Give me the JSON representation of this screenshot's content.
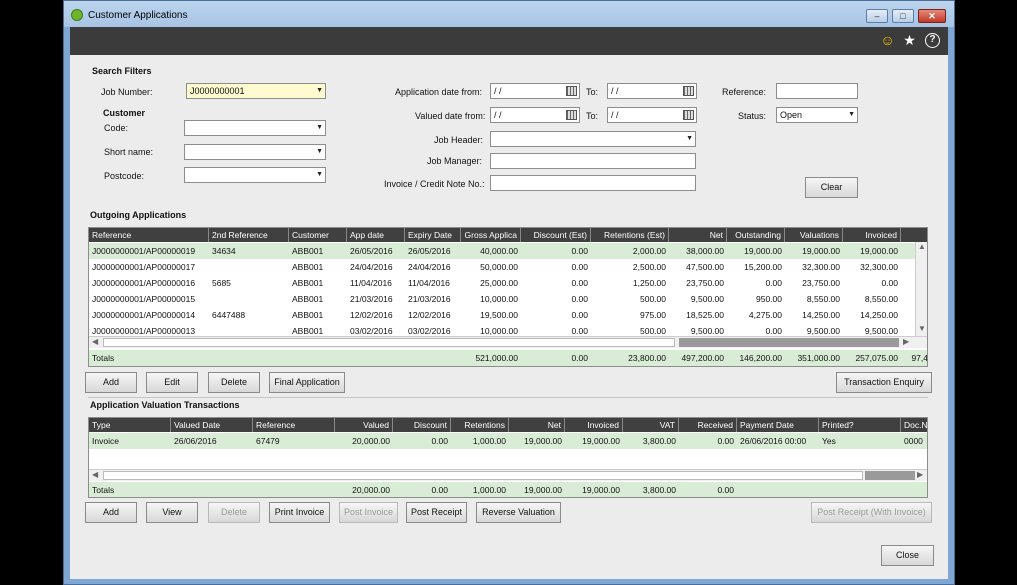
{
  "window": {
    "title": "Customer Applications",
    "min": "–",
    "max": "□",
    "close": "✕"
  },
  "toolbar": {
    "smile_icon": "☺",
    "star_icon": "★",
    "help_icon": "?"
  },
  "filters": {
    "heading": "Search Filters",
    "job_number_label": "Job Number:",
    "job_number_value": "J0000000001",
    "customer_heading": "Customer",
    "code_label": "Code:",
    "short_name_label": "Short name:",
    "postcode_label": "Postcode:",
    "app_date_from_label": "Application date from:",
    "app_date_from_value": "/ /",
    "to_label": "To:",
    "app_date_to_value": "/ /",
    "valued_date_from_label": "Valued date from:",
    "valued_date_from_value": "/ /",
    "valued_date_to_value": "/ /",
    "job_header_label": "Job Header:",
    "job_manager_label": "Job Manager:",
    "invoice_label": "Invoice / Credit Note No.:",
    "reference_label": "Reference:",
    "status_label": "Status:",
    "status_value": "Open",
    "clear_button": "Clear"
  },
  "outgoing": {
    "heading": "Outgoing Applications",
    "columns": [
      "Reference",
      "2nd Reference",
      "Customer",
      "App date",
      "Expiry Date",
      "Gross Applica",
      "Discount (Est)",
      "Retentions (Est)",
      "Net",
      "Outstanding",
      "Valuations",
      "Invoiced"
    ],
    "rows": [
      [
        "J0000000001/AP00000019",
        "34634",
        "ABB001",
        "26/05/2016",
        "26/05/2016",
        "40,000.00",
        "0.00",
        "2,000.00",
        "38,000.00",
        "19,000.00",
        "19,000.00",
        "19,000.00"
      ],
      [
        "J0000000001/AP00000017",
        "",
        "ABB001",
        "24/04/2016",
        "24/04/2016",
        "50,000.00",
        "0.00",
        "2,500.00",
        "47,500.00",
        "15,200.00",
        "32,300.00",
        "32,300.00"
      ],
      [
        "J0000000001/AP00000016",
        "5685",
        "ABB001",
        "11/04/2016",
        "11/04/2016",
        "25,000.00",
        "0.00",
        "1,250.00",
        "23,750.00",
        "0.00",
        "23,750.00",
        "0.00"
      ],
      [
        "J0000000001/AP00000015",
        "",
        "ABB001",
        "21/03/2016",
        "21/03/2016",
        "10,000.00",
        "0.00",
        "500.00",
        "9,500.00",
        "950.00",
        "8,550.00",
        "8,550.00"
      ],
      [
        "J0000000001/AP00000014",
        "6447488",
        "ABB001",
        "12/02/2016",
        "12/02/2016",
        "19,500.00",
        "0.00",
        "975.00",
        "18,525.00",
        "4,275.00",
        "14,250.00",
        "14,250.00"
      ],
      [
        "J0000000001/AP00000013",
        "",
        "ABB001",
        "03/02/2016",
        "03/02/2016",
        "10,000.00",
        "0.00",
        "500.00",
        "9,500.00",
        "0.00",
        "9,500.00",
        "9,500.00"
      ]
    ],
    "totals": {
      "label": "Totals",
      "gross": "521,000.00",
      "discount": "0.00",
      "retentions": "23,800.00",
      "net": "497,200.00",
      "outstanding": "146,200.00",
      "valuations": "351,000.00",
      "invoiced": "257,075.00",
      "extra": "97,4"
    },
    "buttons": {
      "add": "Add",
      "edit": "Edit",
      "delete": "Delete",
      "final": "Final Application",
      "transaction_enquiry": "Transaction Enquiry"
    }
  },
  "valuations": {
    "heading": "Application Valuation Transactions",
    "columns": [
      "Type",
      "Valued Date",
      "Reference",
      "Valued",
      "Discount",
      "Retentions",
      "Net",
      "Invoiced",
      "VAT",
      "Received",
      "Payment Date",
      "Printed?",
      "Doc.N"
    ],
    "rows": [
      [
        "Invoice",
        "26/06/2016",
        "67479",
        "20,000.00",
        "0.00",
        "1,000.00",
        "19,000.00",
        "19,000.00",
        "3,800.00",
        "0.00",
        "26/06/2016 00:00",
        "Yes",
        "0000"
      ]
    ],
    "totals": {
      "label": "Totals",
      "valued": "20,000.00",
      "discount": "0.00",
      "retentions": "1,000.00",
      "net": "19,000.00",
      "invoiced": "19,000.00",
      "vat": "3,800.00",
      "received": "0.00"
    },
    "buttons": {
      "add": "Add",
      "view": "View",
      "delete": "Delete",
      "print_invoice": "Print Invoice",
      "post_invoice": "Post Invoice",
      "post_receipt": "Post Receipt",
      "reverse_valuation": "Reverse Valuation",
      "post_receipt_with_invoice": "Post Receipt (With Invoice)"
    }
  },
  "footer": {
    "close_button": "Close"
  }
}
